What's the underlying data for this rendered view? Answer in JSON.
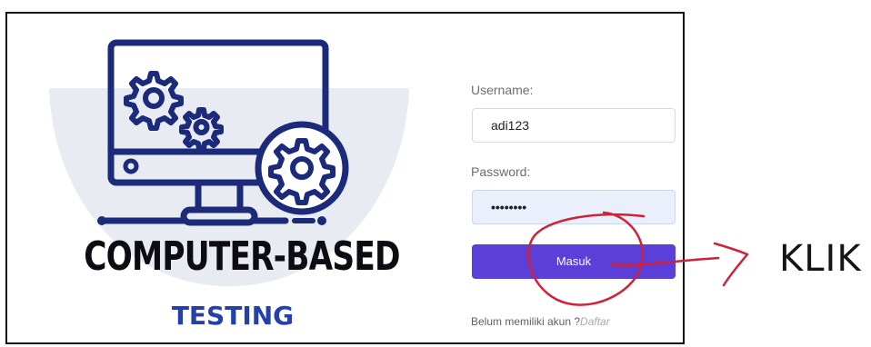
{
  "logo": {
    "line1": "COMPUTER-BASED",
    "line2": "TESTING"
  },
  "form": {
    "username_label": "Username:",
    "username_value": "adi123",
    "password_label": "Password:",
    "password_masked": "••••••••",
    "submit_label": "Masuk",
    "register_prompt": "Belum memiliki akun ?",
    "register_link": "Daftar"
  },
  "annotation": {
    "text": "KLIK"
  },
  "colors": {
    "brand_blue": "#2540a8",
    "button_purple": "#5a3fd8",
    "annotation_red": "#d0203a",
    "dome_gray": "#e8ebf2"
  }
}
